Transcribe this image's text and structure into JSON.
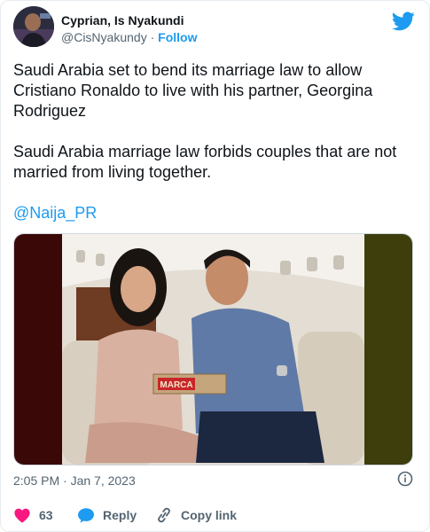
{
  "author": {
    "display_name": "Cyprian, Is Nyakundi",
    "handle": "@CisNyakundy",
    "separator": "·",
    "follow_label": "Follow"
  },
  "tweet": {
    "line1": "Saudi Arabia set to bend its marriage law to allow Cristiano Ronaldo to live with his partner, Georgina Rodriguez",
    "line2": "Saudi Arabia marriage law forbids couples that are not married from living together.",
    "mention": "@Naija_PR"
  },
  "media": {
    "box_text": "MARCA"
  },
  "meta": {
    "timestamp": "2:05 PM · Jan 7, 2023"
  },
  "actions": {
    "like_count": "63",
    "reply_label": "Reply",
    "copy_label": "Copy link"
  },
  "colors": {
    "brand": "#1d9bf0",
    "like": "#f91880",
    "text": "#0f1419",
    "muted": "#536471"
  },
  "icons": [
    "twitter-bird-icon",
    "info-icon",
    "heart-icon",
    "reply-bubble-icon",
    "link-icon"
  ]
}
